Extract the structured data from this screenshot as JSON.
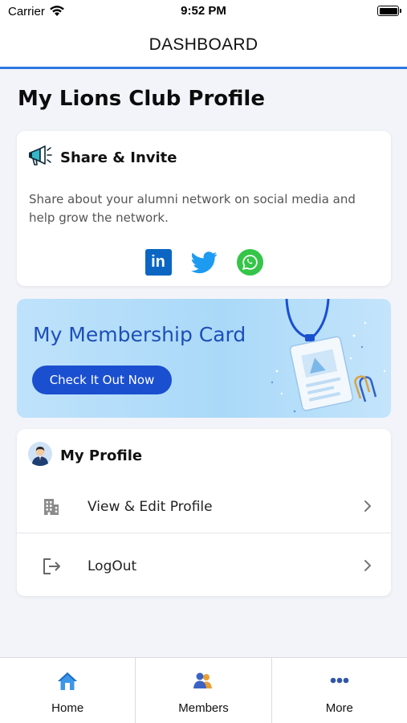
{
  "status_bar": {
    "carrier": "Carrier",
    "time": "9:52 PM"
  },
  "nav": {
    "title": "DASHBOARD"
  },
  "page": {
    "heading": "My Lions Club Profile"
  },
  "share": {
    "title": "Share & Invite",
    "description": "Share about your alumni network on social media and help grow the network.",
    "linkedin_glyph": "in",
    "icons": [
      "megaphone-icon",
      "linkedin-icon",
      "twitter-icon",
      "whatsapp-icon"
    ]
  },
  "membership": {
    "title": "My Membership Card",
    "button_label": "Check It Out Now"
  },
  "profile": {
    "title": "My Profile",
    "items": [
      {
        "label": "View & Edit Profile",
        "icon": "building-icon"
      },
      {
        "label": "LogOut",
        "icon": "logout-icon"
      }
    ]
  },
  "tabs": [
    {
      "label": "Home",
      "icon": "home-icon"
    },
    {
      "label": "Members",
      "icon": "members-icon"
    },
    {
      "label": "More",
      "icon": "more-icon"
    }
  ],
  "colors": {
    "accent_blue": "#2d77e0",
    "button_blue": "#1a4fcf",
    "banner_title": "#1d4fb8",
    "linkedin": "#0a66c2",
    "twitter": "#1d9bf0",
    "whatsapp": "#35c548",
    "background": "#f3f4f9"
  }
}
